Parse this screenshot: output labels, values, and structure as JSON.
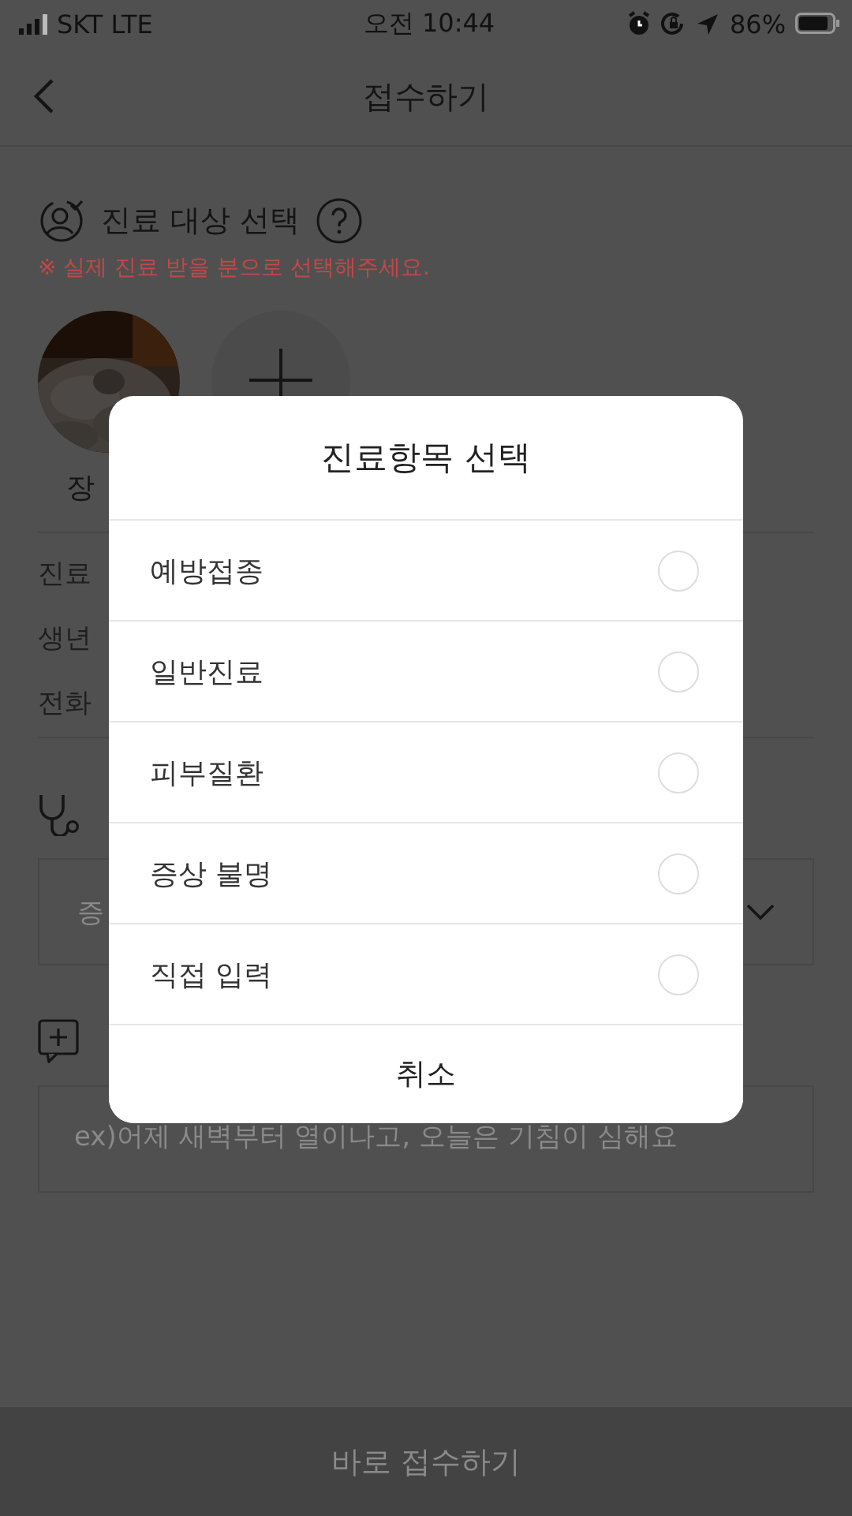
{
  "status_bar": {
    "carrier": "SKT LTE",
    "time": "오전 10:44",
    "battery": "86%"
  },
  "header": {
    "title": "접수하기"
  },
  "patient_section": {
    "title": "진료 대상 선택",
    "note": "※ 실제 진료 받을 분으로 선택해주세요.",
    "profiles": [
      {
        "kind": "picture",
        "name": "장"
      },
      {
        "kind": "add"
      }
    ],
    "info_rows": [
      "진료",
      "생년",
      "전화"
    ]
  },
  "symptom_section": {
    "placeholder": "증"
  },
  "memo_section": {
    "placeholder": "ex)어제 새벽부터 열이나고, 오늘은 기침이 심해요"
  },
  "submit_button": {
    "label": "바로 접수하기",
    "disabled": true
  },
  "dialog": {
    "title": "진료항목 선택",
    "options": [
      {
        "label": "예방접종",
        "selected": false
      },
      {
        "label": "일반진료",
        "selected": false
      },
      {
        "label": "피부질환",
        "selected": false
      },
      {
        "label": "증상 불명",
        "selected": false
      },
      {
        "label": "직접 입력",
        "selected": false
      }
    ],
    "cancel": "취소"
  }
}
